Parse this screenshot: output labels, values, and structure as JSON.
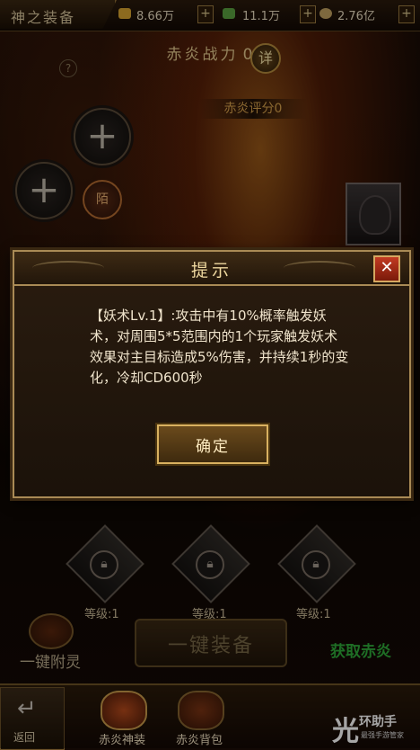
{
  "header": {
    "title": "神之装备",
    "resources": [
      {
        "icon": "gold-icon",
        "value": "8.66万"
      },
      {
        "icon": "jade-icon",
        "value": "11.1万"
      },
      {
        "icon": "coin-icon",
        "value": "2.76亿"
      }
    ],
    "add_label": "+"
  },
  "power": {
    "label": "赤炎战力",
    "value": "0",
    "detail_label": "详"
  },
  "score": {
    "label": "赤炎评分0"
  },
  "help_label": "?",
  "seal_label": "陌",
  "slots": [
    {
      "plus": "+"
    },
    {
      "plus": "+"
    }
  ],
  "locked_slots": [
    {
      "level": "等级:1"
    },
    {
      "level": "等级:1"
    },
    {
      "level": "等级:1"
    }
  ],
  "actions": {
    "attach": "一键附灵",
    "equip_all": "一键装备",
    "obtain": "获取赤炎"
  },
  "bottom_nav": {
    "back": "返回",
    "tabs": [
      "赤炎神装",
      "赤炎背包"
    ]
  },
  "watermark": {
    "mark": "光",
    "name": "环助手",
    "tagline": "最强手游管家"
  },
  "dialog": {
    "title": "提示",
    "close": "✕",
    "message": "【妖术Lv.1】:攻击中有10%概率触发妖术，对周围5*5范围内的1个玩家触发妖术效果对主目标造成5%伤害，并持续1秒的变化，冷却CD600秒",
    "confirm": "确定"
  },
  "colors": {
    "accent": "#d9b160",
    "obtain": "#2eaa3a",
    "close": "#c23a22"
  }
}
